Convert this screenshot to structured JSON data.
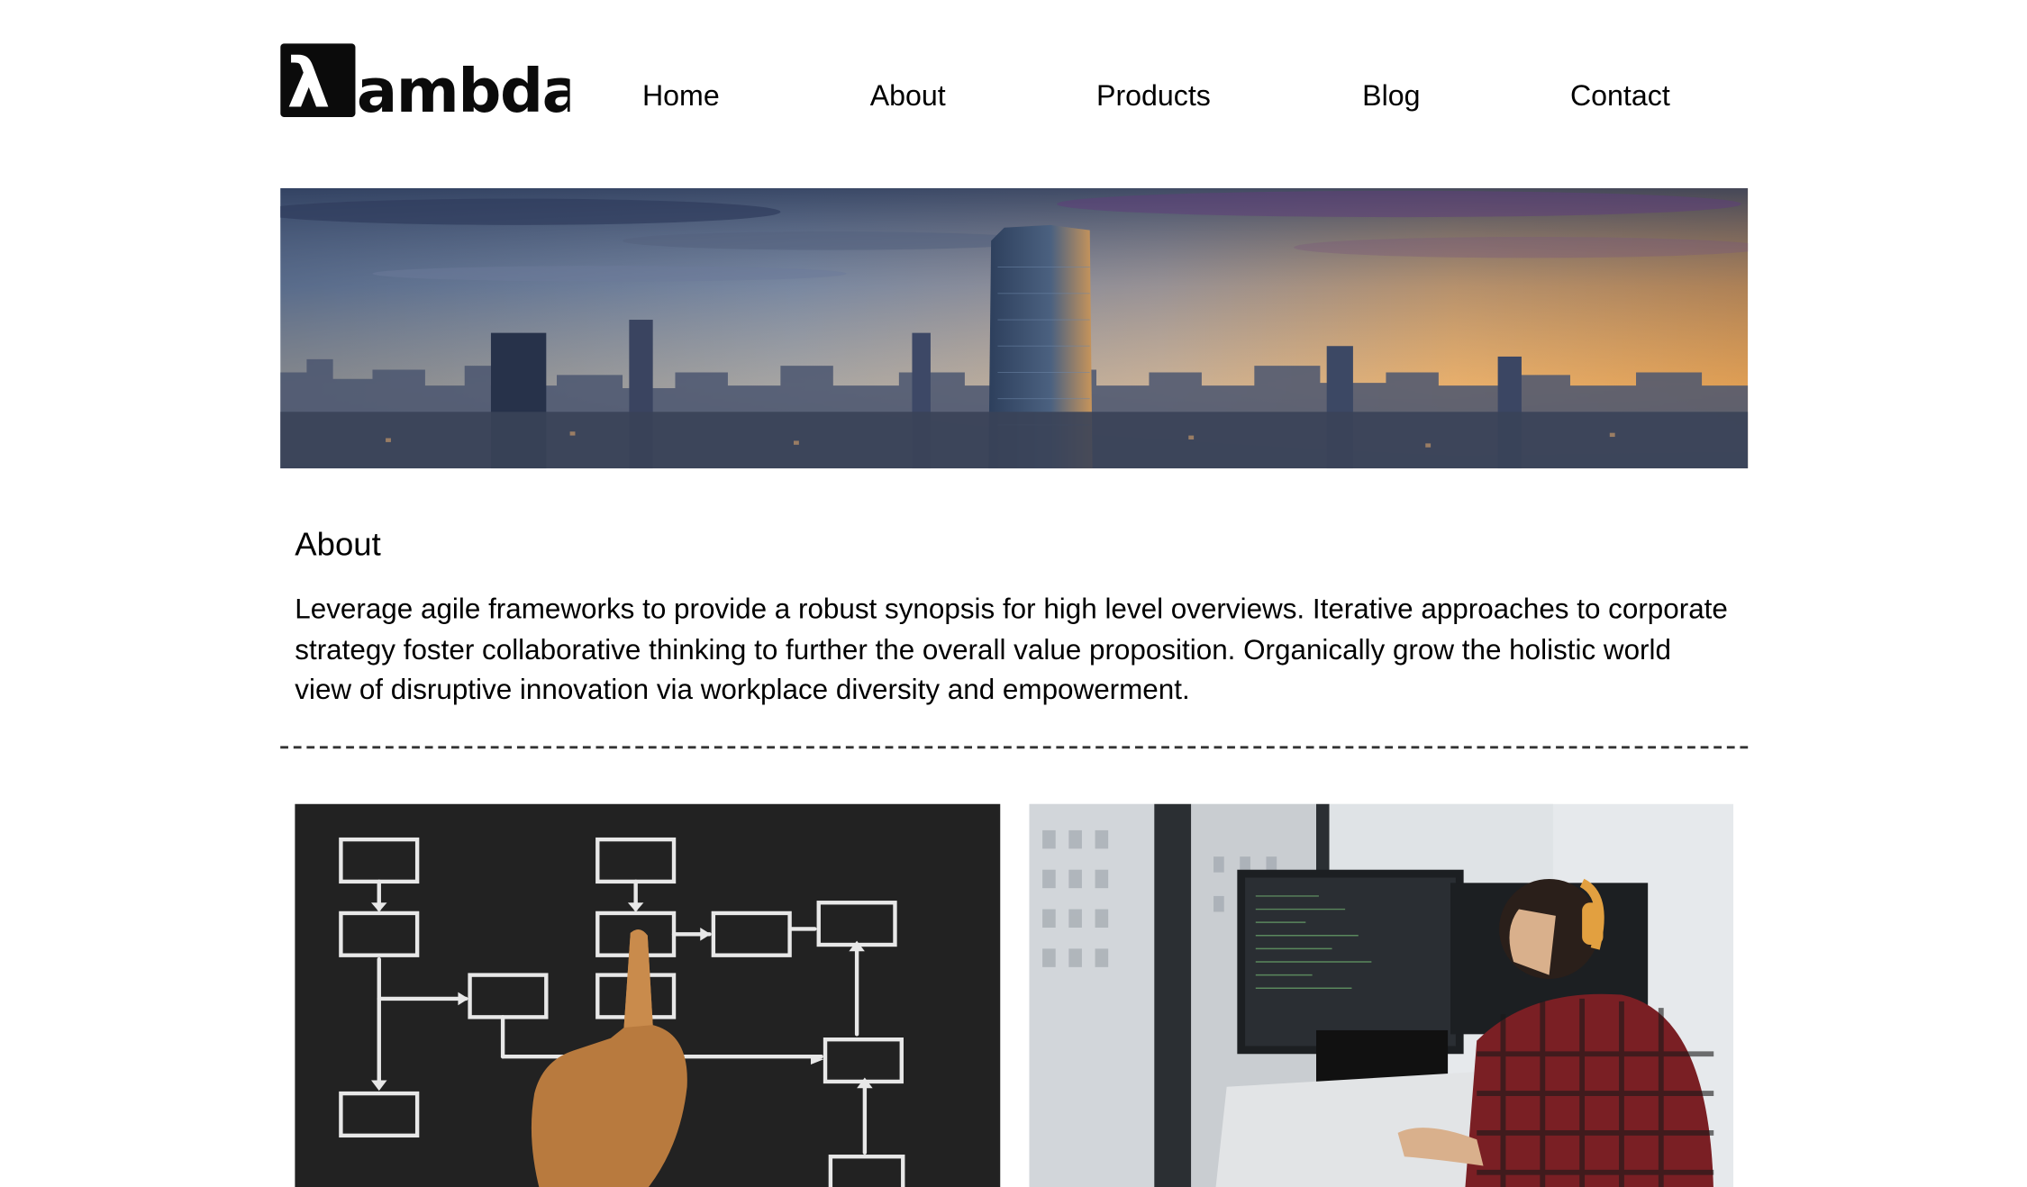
{
  "brand": {
    "logo_symbol": "λ",
    "logo_text": "ambda"
  },
  "nav": {
    "items": [
      {
        "label": "Home"
      },
      {
        "label": "About"
      },
      {
        "label": "Products"
      },
      {
        "label": "Blog"
      },
      {
        "label": "Contact"
      }
    ]
  },
  "about": {
    "title": "About",
    "body": "Leverage agile frameworks to provide a robust synopsis for high level overviews. Iterative approaches to corporate strategy foster collaborative thinking to further the overall value proposition. Organically grow the holistic world view of disruptive innovation via workplace diversity and empowerment."
  },
  "images": {
    "hero": "city-skyline-sunset-image",
    "left": "flowchart-chalkboard-image",
    "right": "developer-at-monitors-image"
  },
  "colors": {
    "text": "#000000",
    "logo_bg": "#0b0b0b",
    "divider": "#333333"
  }
}
